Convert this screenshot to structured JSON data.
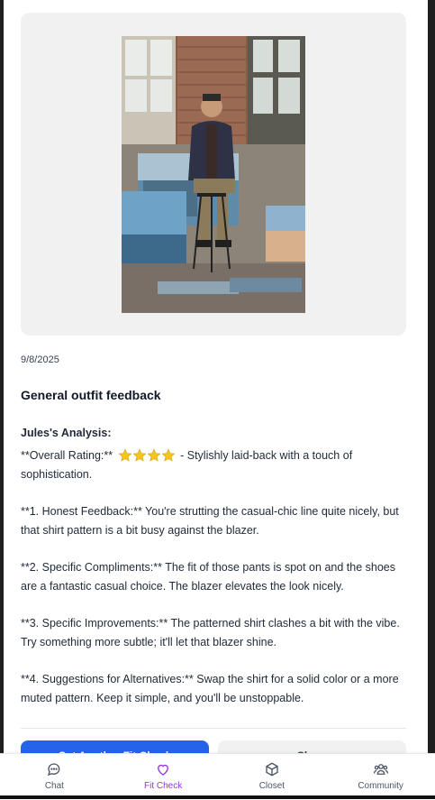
{
  "post": {
    "date": "9/8/2025",
    "title": "General outfit feedback",
    "analysis_heading": "Jules's Analysis:",
    "rating_prefix": "**Overall Rating:**",
    "rating_stars": 4,
    "rating_suffix": "- Stylishly laid-back with a touch of sophistication.",
    "paragraphs": [
      "**1. Honest Feedback:** You're strutting the casual-chic line quite nicely, but that shirt pattern is a bit busy against the blazer.",
      "**2. Specific Compliments:** The fit of those pants is spot on and the shoes are a fantastic casual choice. The blazer elevates the look nicely.",
      "**3. Specific Improvements:** The patterned shirt clashes a bit with the vibe. Try something more subtle; it'll let that blazer shine.",
      "**4. Suggestions for Alternatives:** Swap the shirt for a solid color or a more muted pattern. Keep it simple, and you'll be unstoppable."
    ],
    "primary_button": "Get Another Fit Check",
    "secondary_button": "Share"
  },
  "tabbar": {
    "items": [
      {
        "label": "Chat",
        "icon": "chat-bubble-icon"
      },
      {
        "label": "Fit Check",
        "icon": "heart-icon",
        "active": true
      },
      {
        "label": "Closet",
        "icon": "box-icon"
      },
      {
        "label": "Community",
        "icon": "people-icon"
      }
    ]
  },
  "colors": {
    "primary": "#2563eb",
    "active_tab": "#9333ea",
    "star": "#f5c518"
  }
}
